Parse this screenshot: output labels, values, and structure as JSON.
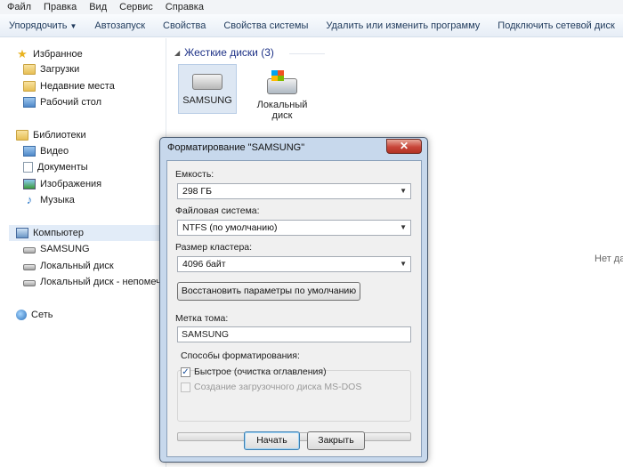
{
  "menu": [
    "Файл",
    "Правка",
    "Вид",
    "Сервис",
    "Справка"
  ],
  "toolbar": {
    "organize": "Упорядочить",
    "autoplay": "Автозапуск",
    "properties": "Свойства",
    "system_properties": "Свойства системы",
    "uninstall": "Удалить или изменить программу",
    "map_drive": "Подключить сетевой диск"
  },
  "nav": {
    "favorites": "Избранное",
    "downloads": "Загрузки",
    "recent": "Недавние места",
    "desktop": "Рабочий стол",
    "libraries": "Библиотеки",
    "video": "Видео",
    "documents": "Документы",
    "images": "Изображения",
    "music": "Музыка",
    "computer": "Компьютер",
    "samsung": "SAMSUNG",
    "local_disk": "Локальный диск",
    "local_disk_unknown": "Локальный диск - непомеченный",
    "network": "Сеть"
  },
  "content": {
    "group_title": "Жесткие диски (3)",
    "drive1": "SAMSUNG",
    "drive2": "Локальный диск",
    "no_data": "Нет данных"
  },
  "dialog": {
    "title": "Форматирование \"SAMSUNG\"",
    "close": "✕",
    "capacity_label": "Емкость:",
    "capacity_value": "298 ГБ",
    "fs_label": "Файловая система:",
    "fs_value": "NTFS (по умолчанию)",
    "cluster_label": "Размер кластера:",
    "cluster_value": "4096 байт",
    "restore_btn": "Восстановить параметры по умолчанию",
    "volume_label": "Метка тома:",
    "volume_value": "SAMSUNG",
    "methods_label": "Способы форматирования:",
    "quick_format": "Быстрое (очистка оглавления)",
    "boot_disk": "Создание загрузочного диска MS-DOS",
    "quick_checked": true,
    "boot_checked": false,
    "progress": 0,
    "start_btn": "Начать",
    "close_btn": "Закрыть"
  }
}
